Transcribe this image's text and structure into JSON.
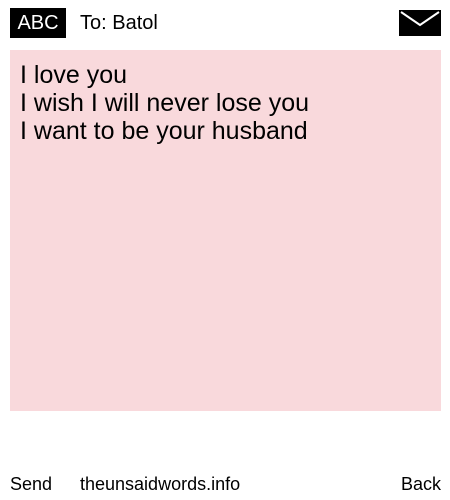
{
  "header": {
    "input_mode": "ABC",
    "recipient": "To: Batol",
    "icon": "envelope-icon"
  },
  "message": {
    "lines": [
      "I love you",
      "I wish I will never lose you",
      "I want to be your husband"
    ],
    "background_color": "#f9d9dc"
  },
  "footer": {
    "send_label": "Send",
    "site_label": "theunsaidwords.info",
    "back_label": "Back"
  }
}
